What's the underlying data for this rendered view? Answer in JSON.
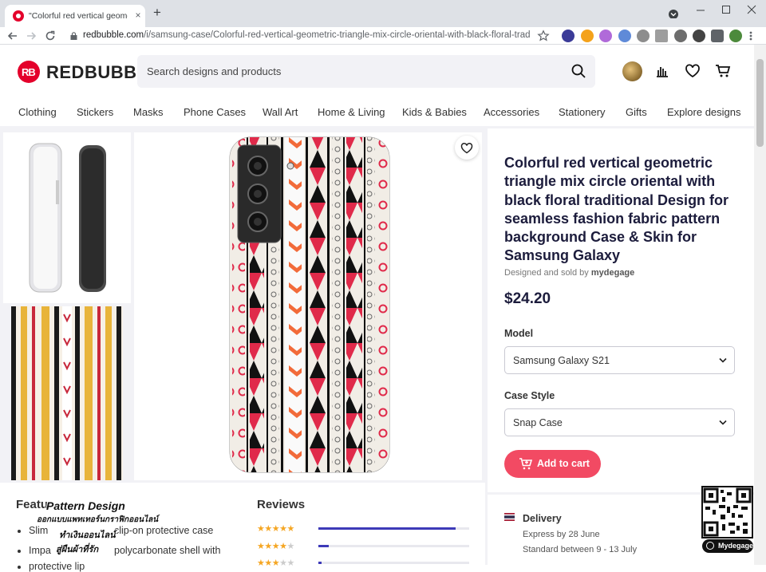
{
  "browser": {
    "tab_title": "\"Colorful red vertical geometric t",
    "tab_close": "×",
    "new_tab": "+",
    "url_domain": "redbubble.com",
    "url_path": "/i/samsung-case/Colorful-red-vertical-geometric-triangle-mix-circle-oriental-with-black-floral-traditional-D..."
  },
  "site": {
    "logo_mark": "RB",
    "logo_text": "REDBUBBLE",
    "search_placeholder": "Search designs and products",
    "categories": [
      "Clothing",
      "Stickers",
      "Masks",
      "Phone Cases",
      "Wall Art",
      "Home & Living",
      "Kids & Babies",
      "Accessories",
      "Stationery",
      "Gifts",
      "Explore designs"
    ]
  },
  "product": {
    "title": "Colorful red vertical geometric triangle mix circle oriental with black floral traditional Design for seamless fashion fabric pattern background Case & Skin for Samsung Galaxy",
    "byline_prefix": "Designed and sold by",
    "artist": "mydegage",
    "price": "$24.20",
    "model_label": "Model",
    "model_value": "Samsung Galaxy S21",
    "style_label": "Case Style",
    "style_value": "Snap Case",
    "add_to_cart": "Add to cart",
    "delivery_heading": "Delivery",
    "delivery_express": "Express by 28 June",
    "delivery_standard": "Standard between 9 - 13 July"
  },
  "features": {
    "heading": "Featu",
    "items": [
      "Slim",
      "clip-on protective case",
      "Impa",
      "polycarbonate shell with",
      "protective lip"
    ]
  },
  "reviews": {
    "heading": "Reviews",
    "rows": [
      {
        "stars": "★★★★★",
        "empty": "",
        "fill": 0.91
      },
      {
        "stars": "★★★★",
        "empty": "★",
        "fill": 0.07
      },
      {
        "stars": "★★★",
        "empty": "★★",
        "fill": 0.02
      }
    ]
  },
  "watermark": {
    "title": "Pattern Design",
    "line1": "ออกแบบแพทเทอร์นกราฟิกออนไลน์",
    "line2": "ทำเงินออนไลน์",
    "line3": "สู่ผืนผ้าที่รัก",
    "badge": "Mydegage"
  },
  "colors": {
    "brand_red": "#e4002b",
    "cta_pink": "#f24a63",
    "title_navy": "#1c1c3c",
    "review_bar": "#3d3ab8",
    "star": "#f5a623"
  }
}
